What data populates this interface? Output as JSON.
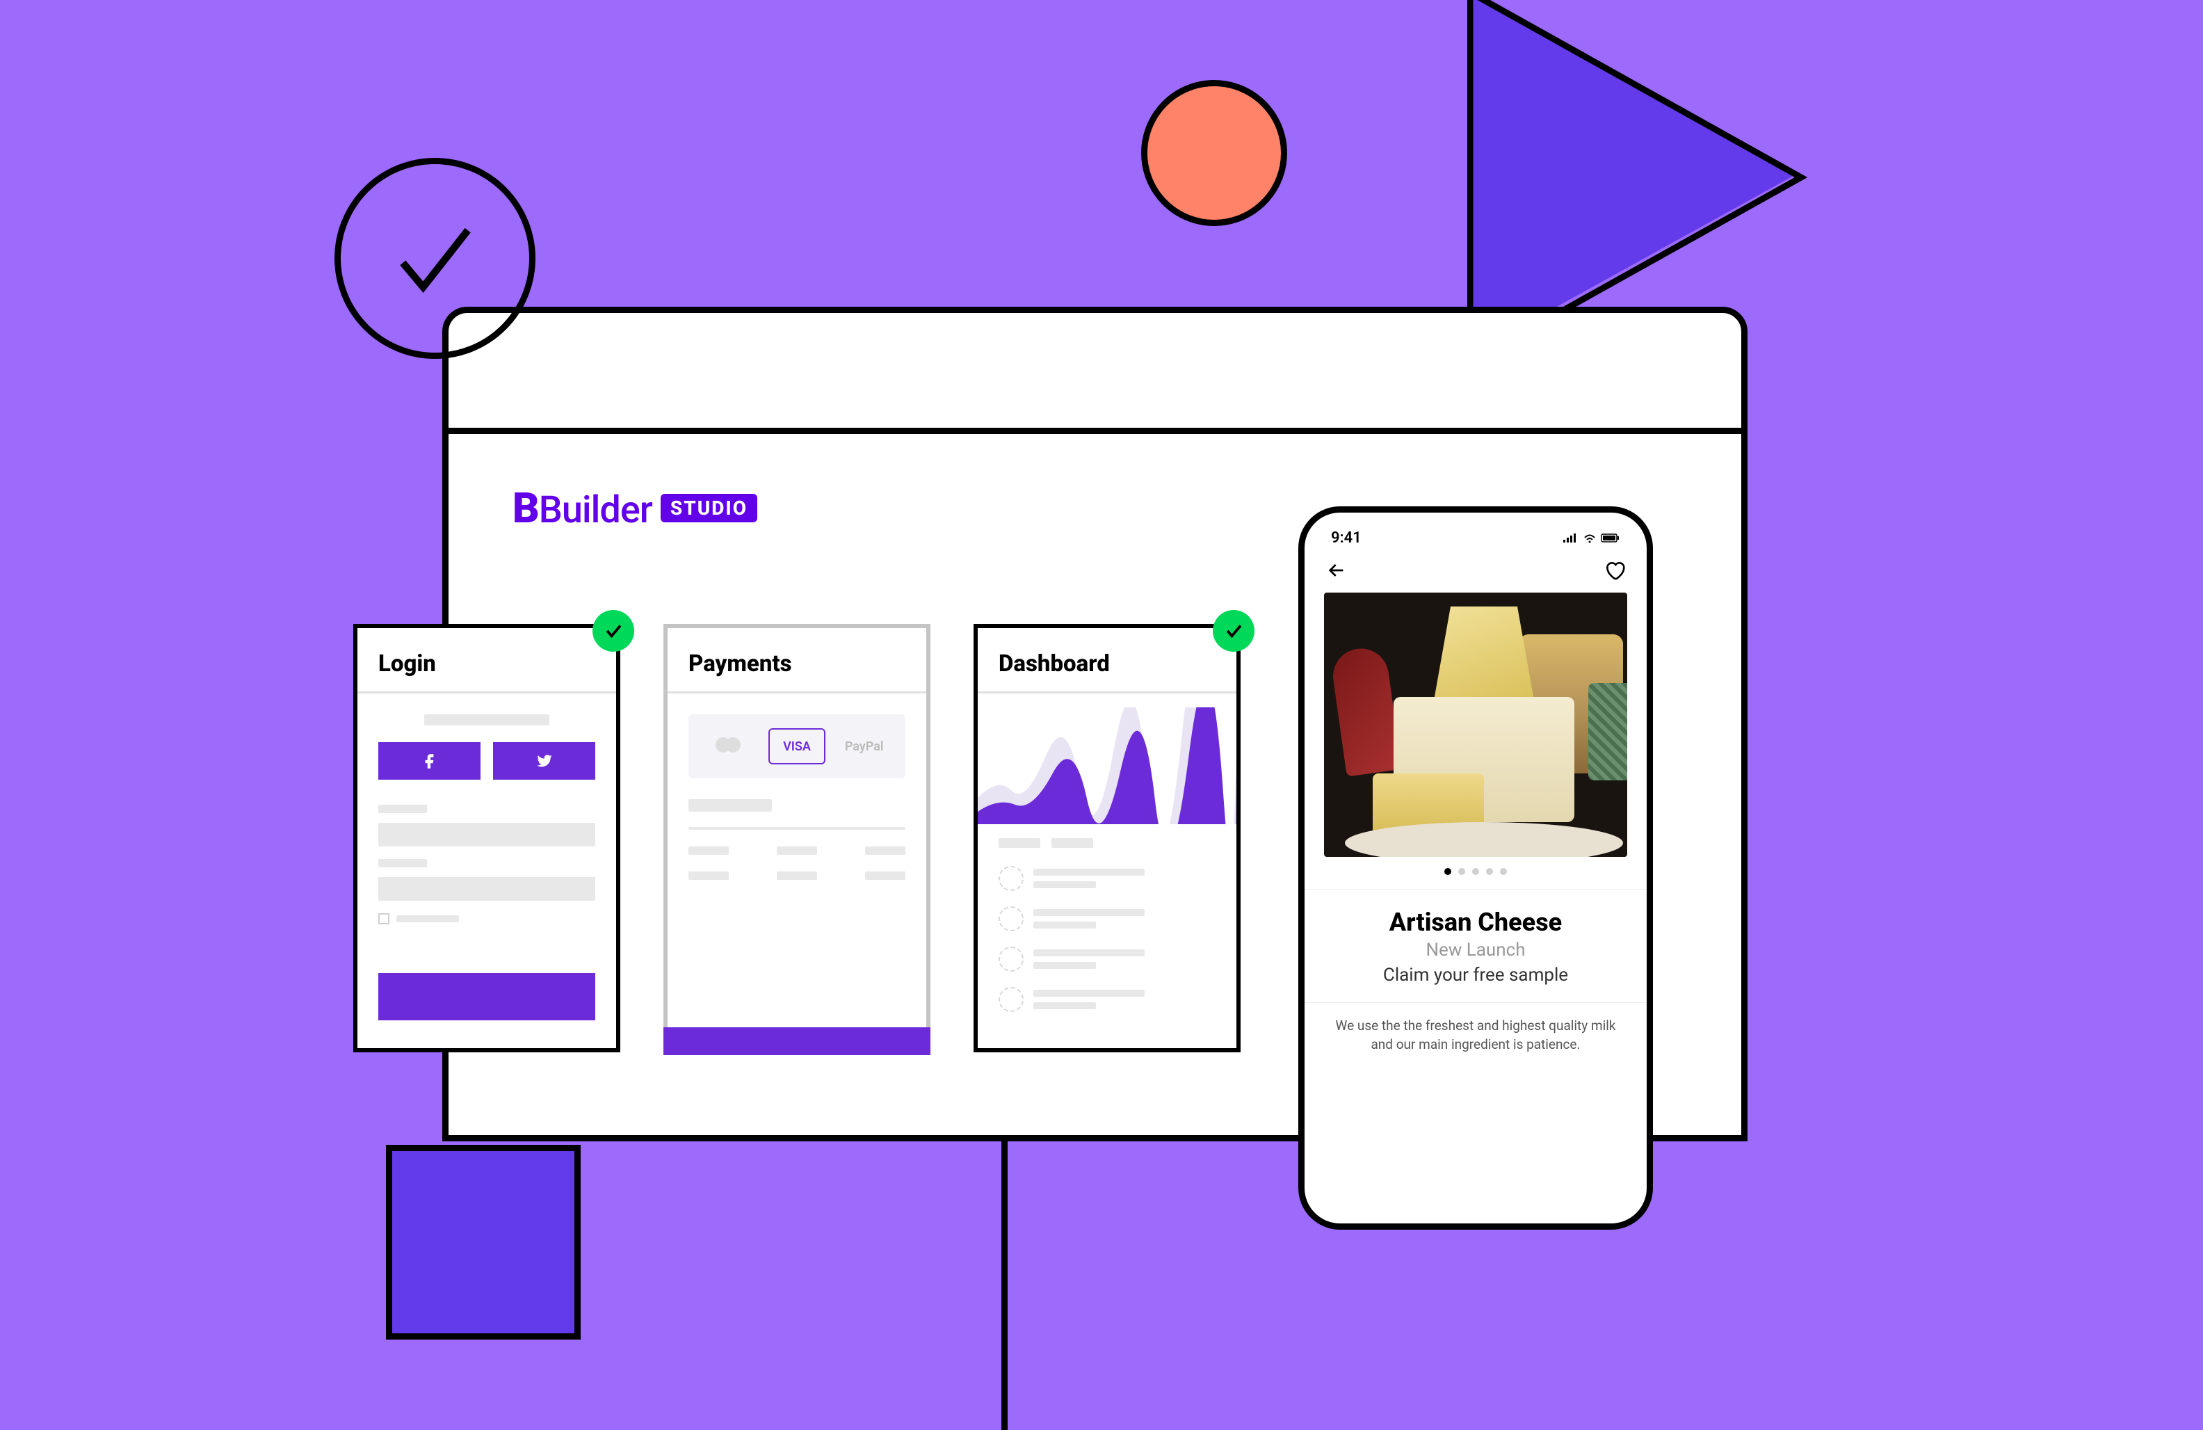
{
  "branding": {
    "name": "Builder",
    "badge": "STUDIO"
  },
  "cards": [
    {
      "title": "Login",
      "checked": true
    },
    {
      "title": "Payments",
      "checked": false,
      "options": [
        "",
        "VISA",
        "PayPal"
      ]
    },
    {
      "title": "Dashboard",
      "checked": true
    }
  ],
  "phone": {
    "time": "9:41",
    "product_title": "Artisan Cheese",
    "subtitle": "New Launch",
    "claim": "Claim your free sample",
    "description": "We use the the freshest and highest quality milk and our main ingredient is patience.",
    "carousel_count": 5,
    "carousel_active": 0
  },
  "colors": {
    "primary": "#6c2bd9",
    "bg": "#9d6bfc",
    "accent": "#ff8368",
    "success": "#00d85a"
  }
}
